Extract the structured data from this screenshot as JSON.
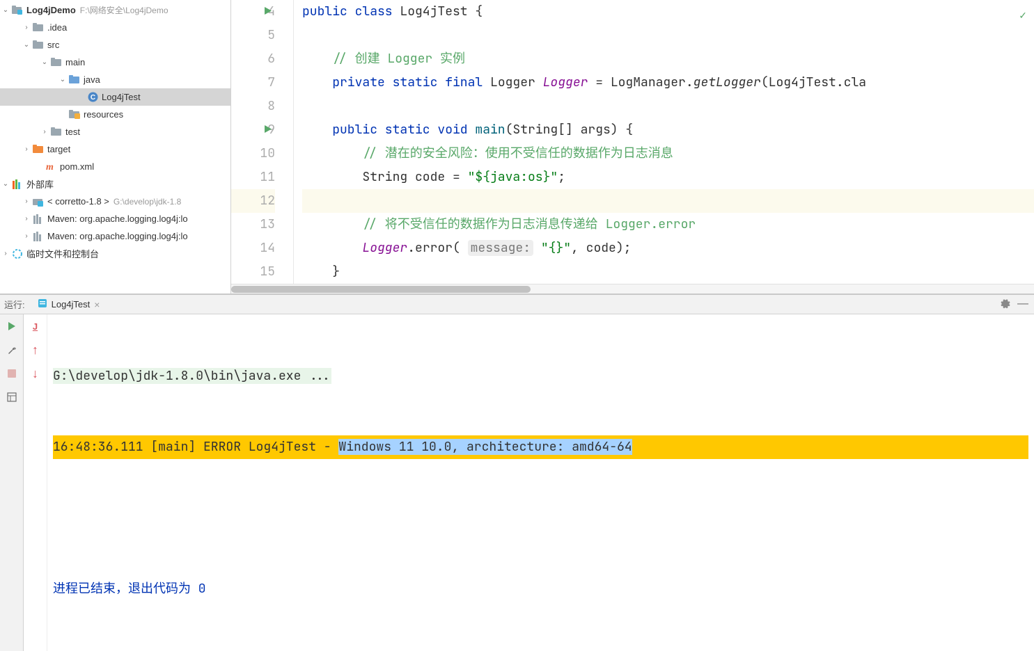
{
  "project": {
    "root": {
      "name": "Log4jDemo",
      "path": "F:\\网络安全\\Log4jDemo"
    },
    "nodes": [
      {
        "name": ".idea",
        "indent": 30,
        "arrow": "›",
        "type": "folder-gray"
      },
      {
        "name": "src",
        "indent": 30,
        "arrow": "⌄",
        "type": "folder-gray"
      },
      {
        "name": "main",
        "indent": 56,
        "arrow": "⌄",
        "type": "folder-gray"
      },
      {
        "name": "java",
        "indent": 82,
        "arrow": "⌄",
        "type": "folder-blue"
      },
      {
        "name": "Log4jTest",
        "indent": 108,
        "arrow": "",
        "type": "class",
        "selected": true
      },
      {
        "name": "resources",
        "indent": 82,
        "arrow": "",
        "type": "folder-res"
      },
      {
        "name": "test",
        "indent": 56,
        "arrow": "›",
        "type": "folder-gray"
      },
      {
        "name": "target",
        "indent": 30,
        "arrow": "›",
        "type": "folder-orange"
      },
      {
        "name": "pom.xml",
        "indent": 48,
        "arrow": "",
        "type": "maven"
      }
    ],
    "external_label": "外部库",
    "externals": [
      {
        "name": "< corretto-1.8 >",
        "path": "G:\\develop\\jdk-1.8",
        "type": "jdk"
      },
      {
        "name": "Maven: org.apache.logging.log4j:lo",
        "type": "lib"
      },
      {
        "name": "Maven: org.apache.logging.log4j:lo",
        "type": "lib"
      }
    ],
    "scratch_label": "临时文件和控制台"
  },
  "editor": {
    "lines": [
      {
        "n": 4,
        "run": true
      },
      {
        "n": 5
      },
      {
        "n": 6
      },
      {
        "n": 7
      },
      {
        "n": 8
      },
      {
        "n": 9,
        "run": true
      },
      {
        "n": 10
      },
      {
        "n": 11
      },
      {
        "n": 12,
        "current": true
      },
      {
        "n": 13
      },
      {
        "n": 14
      },
      {
        "n": 15
      }
    ],
    "code": {
      "l4_kw1": "public class ",
      "l4_cls": "Log4jTest",
      "l4_brace": " {",
      "l6_cmt": "// 创建 Logger 实例",
      "l7_kw": "private static final ",
      "l7_type": "Logger ",
      "l7_fld": "Logger",
      "l7_eq": " = LogManager.",
      "l7_m": "getLogger",
      "l7_tail": "(Log4jTest.cla",
      "l9_kw": "public static void ",
      "l9_m": "main",
      "l9_args": "(String[] args) {",
      "l10_cmt": "// 潜在的安全风险：使用不受信任的数据作为日志消息",
      "l11_a": "String code = ",
      "l11_s": "\"${java:os}\"",
      "l11_b": ";",
      "l13_cmt": "// 将不受信任的数据作为日志消息传递给 Logger.error",
      "l14_a": "Logger",
      "l14_b": ".error( ",
      "l14_hint": "message:",
      "l14_c": " ",
      "l14_s": "\"{}\"",
      "l14_d": ", code);",
      "l15": "}"
    }
  },
  "run": {
    "panel_label": "运行:",
    "tab_name": "Log4jTest",
    "console": {
      "cmd": "G:\\develop\\jdk-1.8.0\\bin\\java.exe ...",
      "err_prefix": "16:48:36.111 [main] ERROR Log4jTest - ",
      "err_selected": "Windows 11 10.0, architecture: amd64-64",
      "exit": "进程已结束，退出代码为 0"
    }
  }
}
